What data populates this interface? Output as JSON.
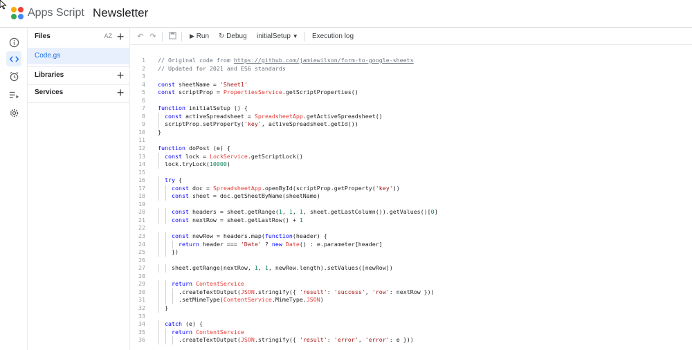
{
  "header": {
    "app_name": "Apps Script",
    "project_title": "Newsletter"
  },
  "rail": {
    "items": [
      "overview",
      "editor",
      "triggers",
      "executions",
      "settings"
    ]
  },
  "files_panel": {
    "files_label": "Files",
    "sort_label": "AZ",
    "file_name": "Code.gs",
    "libraries_label": "Libraries",
    "services_label": "Services"
  },
  "toolbar": {
    "run_label": "Run",
    "debug_label": "Debug",
    "function_select": "initialSetup",
    "execution_log_label": "Execution log"
  },
  "editor": {
    "lines": [
      "// Original code from https://github.com/jamiewilson/form-to-google-sheets",
      "// Updated for 2021 and ES6 standards",
      "",
      "const sheetName = 'Sheet1'",
      "const scriptProp = PropertiesService.getScriptProperties()",
      "",
      "function initialSetup () {",
      "  const activeSpreadsheet = SpreadsheetApp.getActiveSpreadsheet()",
      "  scriptProp.setProperty('key', activeSpreadsheet.getId())",
      "}",
      "",
      "function doPost (e) {",
      "  const lock = LockService.getScriptLock()",
      "  lock.tryLock(10000)",
      "",
      "  try {",
      "    const doc = SpreadsheetApp.openById(scriptProp.getProperty('key'))",
      "    const sheet = doc.getSheetByName(sheetName)",
      "",
      "    const headers = sheet.getRange(1, 1, 1, sheet.getLastColumn()).getValues()[0]",
      "    const nextRow = sheet.getLastRow() + 1",
      "",
      "    const newRow = headers.map(function(header) {",
      "      return header === 'Date' ? new Date() : e.parameter[header]",
      "    })",
      "",
      "    sheet.getRange(nextRow, 1, 1, newRow.length).setValues([newRow])",
      "",
      "    return ContentService",
      "      .createTextOutput(JSON.stringify({ 'result': 'success', 'row': nextRow }))",
      "      .setMimeType(ContentService.MimeType.JSON)",
      "  }",
      "",
      "  catch (e) {",
      "    return ContentService",
      "      .createTextOutput(JSON.stringify({ 'result': 'error', 'error': e }))"
    ]
  },
  "colors": {
    "accent": "#1a73e8",
    "active_bg": "#e8f0fe"
  }
}
